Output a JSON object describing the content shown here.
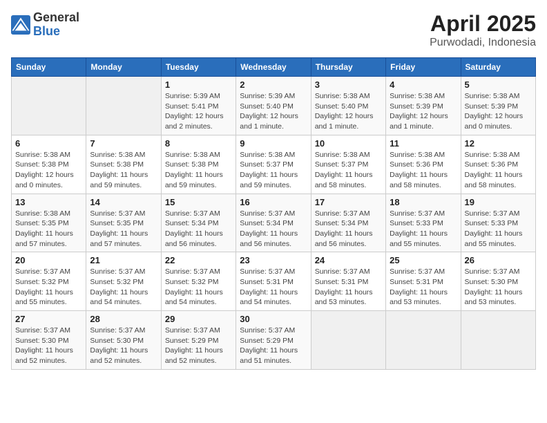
{
  "header": {
    "logo_general": "General",
    "logo_blue": "Blue",
    "title": "April 2025",
    "subtitle": "Purwodadi, Indonesia"
  },
  "calendar": {
    "columns": [
      "Sunday",
      "Monday",
      "Tuesday",
      "Wednesday",
      "Thursday",
      "Friday",
      "Saturday"
    ],
    "rows": [
      [
        {
          "day": "",
          "info": ""
        },
        {
          "day": "",
          "info": ""
        },
        {
          "day": "1",
          "info": "Sunrise: 5:39 AM\nSunset: 5:41 PM\nDaylight: 12 hours\nand 2 minutes."
        },
        {
          "day": "2",
          "info": "Sunrise: 5:39 AM\nSunset: 5:40 PM\nDaylight: 12 hours\nand 1 minute."
        },
        {
          "day": "3",
          "info": "Sunrise: 5:38 AM\nSunset: 5:40 PM\nDaylight: 12 hours\nand 1 minute."
        },
        {
          "day": "4",
          "info": "Sunrise: 5:38 AM\nSunset: 5:39 PM\nDaylight: 12 hours\nand 1 minute."
        },
        {
          "day": "5",
          "info": "Sunrise: 5:38 AM\nSunset: 5:39 PM\nDaylight: 12 hours\nand 0 minutes."
        }
      ],
      [
        {
          "day": "6",
          "info": "Sunrise: 5:38 AM\nSunset: 5:38 PM\nDaylight: 12 hours\nand 0 minutes."
        },
        {
          "day": "7",
          "info": "Sunrise: 5:38 AM\nSunset: 5:38 PM\nDaylight: 11 hours\nand 59 minutes."
        },
        {
          "day": "8",
          "info": "Sunrise: 5:38 AM\nSunset: 5:38 PM\nDaylight: 11 hours\nand 59 minutes."
        },
        {
          "day": "9",
          "info": "Sunrise: 5:38 AM\nSunset: 5:37 PM\nDaylight: 11 hours\nand 59 minutes."
        },
        {
          "day": "10",
          "info": "Sunrise: 5:38 AM\nSunset: 5:37 PM\nDaylight: 11 hours\nand 58 minutes."
        },
        {
          "day": "11",
          "info": "Sunrise: 5:38 AM\nSunset: 5:36 PM\nDaylight: 11 hours\nand 58 minutes."
        },
        {
          "day": "12",
          "info": "Sunrise: 5:38 AM\nSunset: 5:36 PM\nDaylight: 11 hours\nand 58 minutes."
        }
      ],
      [
        {
          "day": "13",
          "info": "Sunrise: 5:38 AM\nSunset: 5:35 PM\nDaylight: 11 hours\nand 57 minutes."
        },
        {
          "day": "14",
          "info": "Sunrise: 5:37 AM\nSunset: 5:35 PM\nDaylight: 11 hours\nand 57 minutes."
        },
        {
          "day": "15",
          "info": "Sunrise: 5:37 AM\nSunset: 5:34 PM\nDaylight: 11 hours\nand 56 minutes."
        },
        {
          "day": "16",
          "info": "Sunrise: 5:37 AM\nSunset: 5:34 PM\nDaylight: 11 hours\nand 56 minutes."
        },
        {
          "day": "17",
          "info": "Sunrise: 5:37 AM\nSunset: 5:34 PM\nDaylight: 11 hours\nand 56 minutes."
        },
        {
          "day": "18",
          "info": "Sunrise: 5:37 AM\nSunset: 5:33 PM\nDaylight: 11 hours\nand 55 minutes."
        },
        {
          "day": "19",
          "info": "Sunrise: 5:37 AM\nSunset: 5:33 PM\nDaylight: 11 hours\nand 55 minutes."
        }
      ],
      [
        {
          "day": "20",
          "info": "Sunrise: 5:37 AM\nSunset: 5:32 PM\nDaylight: 11 hours\nand 55 minutes."
        },
        {
          "day": "21",
          "info": "Sunrise: 5:37 AM\nSunset: 5:32 PM\nDaylight: 11 hours\nand 54 minutes."
        },
        {
          "day": "22",
          "info": "Sunrise: 5:37 AM\nSunset: 5:32 PM\nDaylight: 11 hours\nand 54 minutes."
        },
        {
          "day": "23",
          "info": "Sunrise: 5:37 AM\nSunset: 5:31 PM\nDaylight: 11 hours\nand 54 minutes."
        },
        {
          "day": "24",
          "info": "Sunrise: 5:37 AM\nSunset: 5:31 PM\nDaylight: 11 hours\nand 53 minutes."
        },
        {
          "day": "25",
          "info": "Sunrise: 5:37 AM\nSunset: 5:31 PM\nDaylight: 11 hours\nand 53 minutes."
        },
        {
          "day": "26",
          "info": "Sunrise: 5:37 AM\nSunset: 5:30 PM\nDaylight: 11 hours\nand 53 minutes."
        }
      ],
      [
        {
          "day": "27",
          "info": "Sunrise: 5:37 AM\nSunset: 5:30 PM\nDaylight: 11 hours\nand 52 minutes."
        },
        {
          "day": "28",
          "info": "Sunrise: 5:37 AM\nSunset: 5:30 PM\nDaylight: 11 hours\nand 52 minutes."
        },
        {
          "day": "29",
          "info": "Sunrise: 5:37 AM\nSunset: 5:29 PM\nDaylight: 11 hours\nand 52 minutes."
        },
        {
          "day": "30",
          "info": "Sunrise: 5:37 AM\nSunset: 5:29 PM\nDaylight: 11 hours\nand 51 minutes."
        },
        {
          "day": "",
          "info": ""
        },
        {
          "day": "",
          "info": ""
        },
        {
          "day": "",
          "info": ""
        }
      ]
    ]
  }
}
